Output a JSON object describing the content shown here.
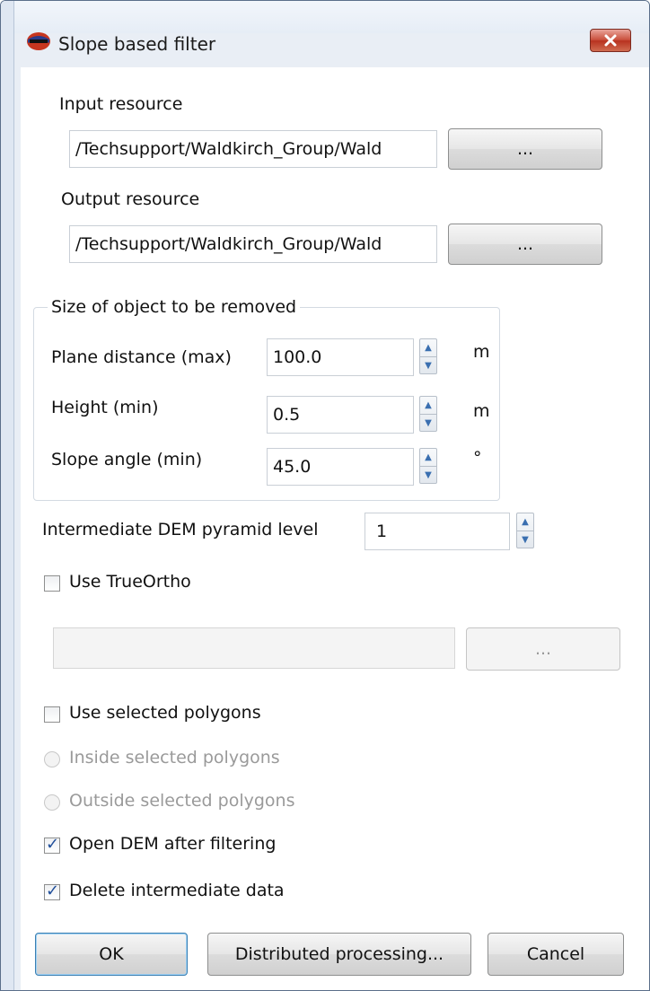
{
  "window": {
    "title": "Slope based filter"
  },
  "input": {
    "label": "Input resource",
    "value": "/Techsupport/Waldkirch_Group/Wald",
    "browse_label": "..."
  },
  "output": {
    "label": "Output resource",
    "value": "/Techsupport/Waldkirch_Group/Wald",
    "browse_label": "..."
  },
  "size_group": {
    "title": "Size of object to be removed",
    "plane": {
      "label": "Plane distance (max)",
      "value": "100.0",
      "unit": "m"
    },
    "height": {
      "label": "Height (min)",
      "value": "0.5",
      "unit": "m"
    },
    "slope": {
      "label": "Slope angle (min)",
      "value": "45.0",
      "unit": "°"
    }
  },
  "pyramid": {
    "label": "Intermediate DEM pyramid level",
    "value": "1"
  },
  "trueortho": {
    "label": "Use TrueOrtho",
    "checked": false,
    "path_value": "",
    "browse_label": "..."
  },
  "polygons": {
    "use_label": "Use selected polygons",
    "use_checked": false,
    "inside_label": "Inside selected polygons",
    "outside_label": "Outside selected polygons"
  },
  "open_dem": {
    "label": "Open DEM after filtering",
    "checked": true
  },
  "delete_data": {
    "label": "Delete intermediate data",
    "checked": true
  },
  "buttons": {
    "ok": "OK",
    "distributed": "Distributed processing...",
    "cancel": "Cancel"
  },
  "colors": {
    "accent": "#3c7fb1",
    "close": "#c94f3c",
    "check": "#1f4e9a"
  }
}
